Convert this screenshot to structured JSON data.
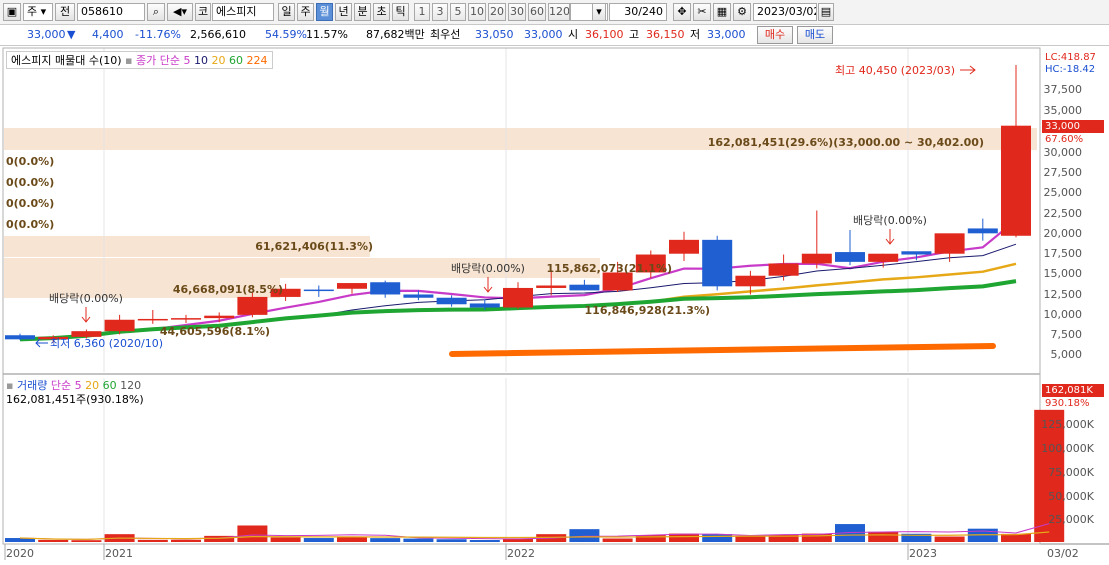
{
  "toolbar": {
    "menu_icon": "window-menu-icon",
    "market_select": "주",
    "market_prefix": "전",
    "stock_code": "058610",
    "market_label": "코",
    "stock_name": "에스피지",
    "period_buttons": [
      "일",
      "주",
      "월",
      "년",
      "분",
      "초",
      "틱"
    ],
    "active_period": "월",
    "interval_buttons": [
      "1",
      "3",
      "5",
      "10",
      "20",
      "30",
      "60",
      "120"
    ],
    "count_display": "30/240",
    "date_value": "2023/03/02"
  },
  "quote": {
    "price": "33,000",
    "direction_arrow": "▼",
    "change": "4,400",
    "change_pct": "-11.76%",
    "volume": "2,566,610",
    "volume_ratio": "54.59%",
    "turnover_rate": "11.57%",
    "amount": "87,682백만",
    "best_bid_label": "최우선",
    "best_bid": "33,050",
    "best_ask": "33,000",
    "open_label": "시",
    "open": "36,100",
    "high_label": "고",
    "high": "36,150",
    "low_label": "저",
    "low": "33,000",
    "buy_button": "매수",
    "sell_button": "매도"
  },
  "price_panel": {
    "legend_title": "에스피지 매물대 수(10)",
    "ma_label": "종가 단순",
    "ma_periods": [
      "5",
      "10",
      "20",
      "60",
      "224"
    ],
    "ma_colors": [
      "#c83ac8",
      "#1a1a6e",
      "#e6a817",
      "#1fa531",
      "#ff6a00"
    ],
    "lc_label": "LC:418.87",
    "hc_label": "HC:-18.42",
    "current_price_tag": "33,000",
    "current_pct_tag": "67.60%",
    "high_annotation": "최고 40,450 (2023/03)",
    "low_annotation": "최저 6,360 (2020/10)",
    "y_ticks": [
      "37,500",
      "35,000",
      "30,000",
      "27,500",
      "25,000",
      "22,500",
      "20,000",
      "17,500",
      "15,000",
      "12,500",
      "10,000",
      "7,500",
      "5,000"
    ],
    "volume_profile_labels": [
      "162,081,451(29.6%)(33,000.00 ~ 30,402.00)",
      "0(0.0%)",
      "0(0.0%)",
      "0(0.0%)",
      "0(0.0%)",
      "61,621,406(11.3%)",
      "115,862,073(21.1%)",
      "46,668,091(8.5%)",
      "116,846,928(21.3%)",
      "44,605,596(8.1%)"
    ],
    "dividend_label": "배당락(0.00%)"
  },
  "volume_panel": {
    "legend_title": "거래량",
    "ma_label": "단순",
    "ma_periods": [
      "5",
      "20",
      "60",
      "120"
    ],
    "ma_colors": [
      "#c83ac8",
      "#e6a817",
      "#1fa531",
      "#555555"
    ],
    "current_volume_text": "162,081,451주(930.18%)",
    "volume_tag": "162,081K",
    "volume_pct_tag": "930.18%",
    "y_ticks": [
      "125,000K",
      "100,000K",
      "75,000K",
      "50,000K",
      "25,000K"
    ]
  },
  "x_axis": {
    "labels": [
      "2020",
      "2021",
      "2022",
      "2023"
    ],
    "right_label": "03/02"
  },
  "chart_data": {
    "type": "candlestick",
    "title": "에스피지 월봉",
    "candles": [
      {
        "o": 7300,
        "h": 7500,
        "l": 6700,
        "c": 6800
      },
      {
        "o": 6800,
        "h": 7300,
        "l": 6360,
        "c": 7100
      },
      {
        "o": 7100,
        "h": 8000,
        "l": 6900,
        "c": 7800
      },
      {
        "o": 7800,
        "h": 9800,
        "l": 7400,
        "c": 9200
      },
      {
        "o": 9200,
        "h": 10400,
        "l": 8700,
        "c": 9300
      },
      {
        "o": 9300,
        "h": 9800,
        "l": 8800,
        "c": 9400
      },
      {
        "o": 9400,
        "h": 10100,
        "l": 8900,
        "c": 9700
      },
      {
        "o": 9800,
        "h": 12500,
        "l": 9500,
        "c": 12000
      },
      {
        "o": 12000,
        "h": 13600,
        "l": 11500,
        "c": 13000
      },
      {
        "o": 12900,
        "h": 13400,
        "l": 12000,
        "c": 12800
      },
      {
        "o": 13000,
        "h": 13700,
        "l": 12400,
        "c": 13700
      },
      {
        "o": 13800,
        "h": 14000,
        "l": 11900,
        "c": 12300
      },
      {
        "o": 12300,
        "h": 12800,
        "l": 11600,
        "c": 11900
      },
      {
        "o": 11900,
        "h": 12200,
        "l": 10800,
        "c": 11100
      },
      {
        "o": 11200,
        "h": 11700,
        "l": 10400,
        "c": 10700
      },
      {
        "o": 10700,
        "h": 13800,
        "l": 10500,
        "c": 13100
      },
      {
        "o": 13100,
        "h": 15300,
        "l": 12200,
        "c": 13400
      },
      {
        "o": 13500,
        "h": 14100,
        "l": 12800,
        "c": 12800
      },
      {
        "o": 12800,
        "h": 16300,
        "l": 12600,
        "c": 15000
      },
      {
        "o": 15000,
        "h": 17700,
        "l": 14300,
        "c": 17200
      },
      {
        "o": 17300,
        "h": 20000,
        "l": 16400,
        "c": 19000
      },
      {
        "o": 19000,
        "h": 19500,
        "l": 12800,
        "c": 13300
      },
      {
        "o": 13300,
        "h": 15200,
        "l": 12300,
        "c": 14600
      },
      {
        "o": 14600,
        "h": 17200,
        "l": 14000,
        "c": 16100
      },
      {
        "o": 16100,
        "h": 22600,
        "l": 15500,
        "c": 17300
      },
      {
        "o": 17500,
        "h": 20200,
        "l": 15900,
        "c": 16300
      },
      {
        "o": 16300,
        "h": 17300,
        "l": 15600,
        "c": 17300
      },
      {
        "o": 17600,
        "h": 17500,
        "l": 16500,
        "c": 17200
      },
      {
        "o": 17300,
        "h": 19500,
        "l": 16300,
        "c": 19800
      },
      {
        "o": 20400,
        "h": 21600,
        "l": 18900,
        "c": 19800
      },
      {
        "o": 19500,
        "h": 40450,
        "l": 19300,
        "c": 33000
      }
    ],
    "volume": [
      4200,
      2200,
      1900,
      8300,
      2300,
      2400,
      6500,
      17500,
      4800,
      4200,
      5100,
      4100,
      3600,
      2900,
      2100,
      3600,
      8300,
      13600,
      3700,
      7300,
      8900,
      8400,
      6400,
      7800,
      8900,
      19000,
      10800,
      8700,
      5800,
      14100,
      8600,
      162081
    ],
    "y_unit_volume": "K",
    "ylim": [
      3500,
      41000
    ]
  }
}
